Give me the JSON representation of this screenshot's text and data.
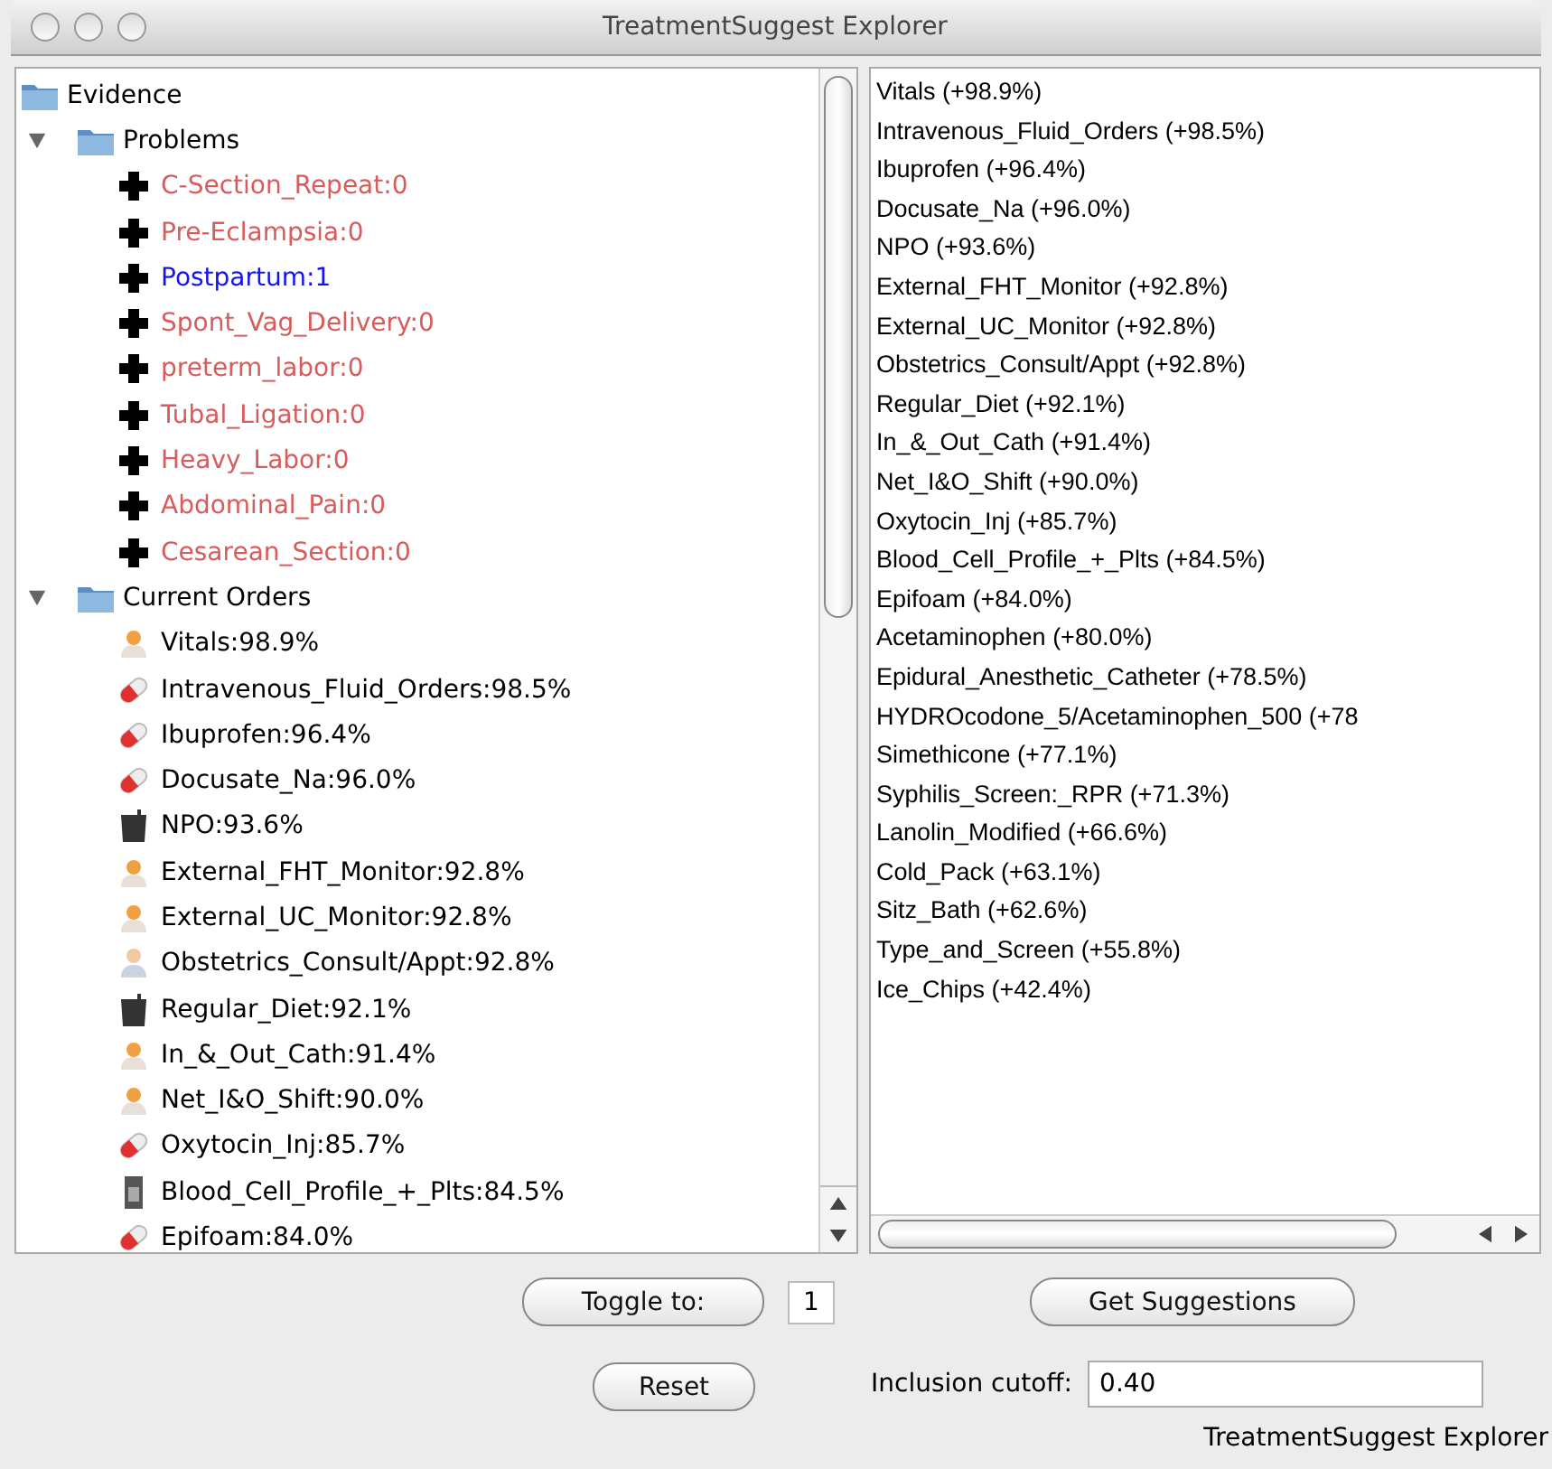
{
  "window": {
    "title": "TreatmentSuggest Explorer"
  },
  "evidence_tree": {
    "label": "Evidence",
    "children": [
      {
        "label": "Problems",
        "expanded": true,
        "children": [
          {
            "label": "C-Section_Repeat:0",
            "kind": "problem",
            "active": false
          },
          {
            "label": "Pre-Eclampsia:0",
            "kind": "problem",
            "active": false
          },
          {
            "label": "Postpartum:1",
            "kind": "problem",
            "active": true
          },
          {
            "label": "Spont_Vag_Delivery:0",
            "kind": "problem",
            "active": false
          },
          {
            "label": "preterm_labor:0",
            "kind": "problem",
            "active": false
          },
          {
            "label": "Tubal_Ligation:0",
            "kind": "problem",
            "active": false
          },
          {
            "label": "Heavy_Labor:0",
            "kind": "problem",
            "active": false
          },
          {
            "label": "Abdominal_Pain:0",
            "kind": "problem",
            "active": false
          },
          {
            "label": "Cesarean_Section:0",
            "kind": "problem",
            "active": false
          }
        ]
      },
      {
        "label": "Current Orders",
        "expanded": true,
        "children": [
          {
            "label": "Vitals:98.9%",
            "kind": "nursing"
          },
          {
            "label": "Intravenous_Fluid_Orders:98.5%",
            "kind": "medication"
          },
          {
            "label": "Ibuprofen:96.4%",
            "kind": "medication"
          },
          {
            "label": "Docusate_Na:96.0%",
            "kind": "medication"
          },
          {
            "label": "NPO:93.6%",
            "kind": "diet"
          },
          {
            "label": "External_FHT_Monitor:92.8%",
            "kind": "nursing"
          },
          {
            "label": "External_UC_Monitor:92.8%",
            "kind": "nursing"
          },
          {
            "label": "Obstetrics_Consult/Appt:92.8%",
            "kind": "consult"
          },
          {
            "label": "Regular_Diet:92.1%",
            "kind": "diet"
          },
          {
            "label": "In_&_Out_Cath:91.4%",
            "kind": "nursing"
          },
          {
            "label": "Net_I&O_Shift:90.0%",
            "kind": "nursing"
          },
          {
            "label": "Oxytocin_Inj:85.7%",
            "kind": "medication"
          },
          {
            "label": "Blood_Cell_Profile_+_Plts:84.5%",
            "kind": "lab"
          },
          {
            "label": "Epifoam:84.0%",
            "kind": "medication"
          }
        ]
      }
    ]
  },
  "suggestions": [
    "Vitals (+98.9%)",
    "Intravenous_Fluid_Orders (+98.5%)",
    "Ibuprofen (+96.4%)",
    "Docusate_Na (+96.0%)",
    "NPO (+93.6%)",
    "External_FHT_Monitor (+92.8%)",
    "External_UC_Monitor (+92.8%)",
    "Obstetrics_Consult/Appt (+92.8%)",
    "Regular_Diet (+92.1%)",
    "In_&_Out_Cath (+91.4%)",
    "Net_I&O_Shift (+90.0%)",
    "Oxytocin_Inj (+85.7%)",
    "Blood_Cell_Profile_+_Plts (+84.5%)",
    "Epifoam (+84.0%)",
    "Acetaminophen (+80.0%)",
    "Epidural_Anesthetic_Catheter (+78.5%)",
    "HYDROcodone_5/Acetaminophen_500 (+78",
    "Simethicone (+77.1%)",
    "Syphilis_Screen:_RPR (+71.3%)",
    "Lanolin_Modified (+66.6%)",
    "Cold_Pack (+63.1%)",
    "Sitz_Bath (+62.6%)",
    "Type_and_Screen (+55.8%)",
    "Ice_Chips (+42.4%)"
  ],
  "toggle": {
    "button": "Toggle to:",
    "value": "1"
  },
  "get_suggestions_button": "Get Suggestions",
  "reset_button": "Reset",
  "cutoff": {
    "label": "Inclusion cutoff:",
    "value": "0.40"
  },
  "status": "TreatmentSuggest Explorer"
}
